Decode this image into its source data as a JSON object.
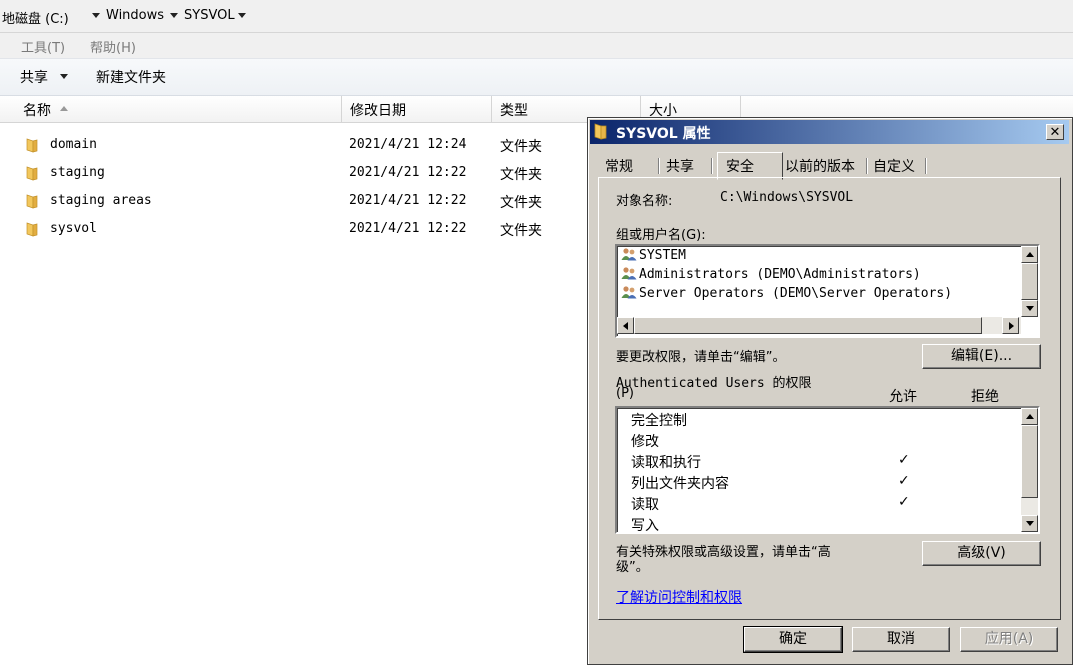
{
  "address": {
    "crumbs": [
      "地磁盘 (C:)",
      "Windows",
      "SYSVOL"
    ]
  },
  "menu": {
    "items": [
      "工具(T)",
      "帮助(H)"
    ]
  },
  "toolbar": {
    "share": "共享",
    "new_folder": "新建文件夹"
  },
  "columns": {
    "name": "名称",
    "date": "修改日期",
    "type": "类型",
    "size": "大小"
  },
  "files": [
    {
      "name": "domain",
      "date": "2021/4/21 12:24",
      "type": "文件夹"
    },
    {
      "name": "staging",
      "date": "2021/4/21 12:22",
      "type": "文件夹"
    },
    {
      "name": "staging areas",
      "date": "2021/4/21 12:22",
      "type": "文件夹"
    },
    {
      "name": "sysvol",
      "date": "2021/4/21 12:22",
      "type": "文件夹"
    }
  ],
  "dialog": {
    "title": "SYSVOL 属性",
    "close_glyph": "✕",
    "tabs": [
      "常规",
      "共享",
      "安全",
      "以前的版本",
      "自定义"
    ],
    "active_tab": "安全",
    "object_label": "对象名称:",
    "object_value": "C:\\Windows\\SYSVOL",
    "groups_label": "组或用户名(G):",
    "groups": [
      "SYSTEM",
      "Administrators (DEMO\\Administrators)",
      "Server Operators (DEMO\\Server Operators)"
    ],
    "change_hint": "要更改权限，请单击“编辑”。",
    "edit_button": "编辑(E)...",
    "perm_label_line1": "Authenticated Users 的权限",
    "perm_label_line2": "(P)",
    "allow_header": "允许",
    "deny_header": "拒绝",
    "permissions": [
      {
        "name": "完全控制",
        "allow": ""
      },
      {
        "name": "修改",
        "allow": ""
      },
      {
        "name": "读取和执行",
        "allow": "✓"
      },
      {
        "name": "列出文件夹内容",
        "allow": "✓"
      },
      {
        "name": "读取",
        "allow": "✓"
      },
      {
        "name": "写入",
        "allow": ""
      }
    ],
    "advanced_hint_line1": "有关特殊权限或高级设置，请单击“高",
    "advanced_hint_line2": "级”。",
    "advanced_button": "高级(V)",
    "learn_link": "了解访问控制和权限",
    "ok_button": "确定",
    "cancel_button": "取消",
    "apply_button": "应用(A)"
  },
  "colors": {
    "title_gradient_start": "#0a246a",
    "title_gradient_end": "#a6caf0",
    "dialog_face": "#d4d0c8",
    "link": "#0000ff",
    "folder": "#e8b84a"
  }
}
